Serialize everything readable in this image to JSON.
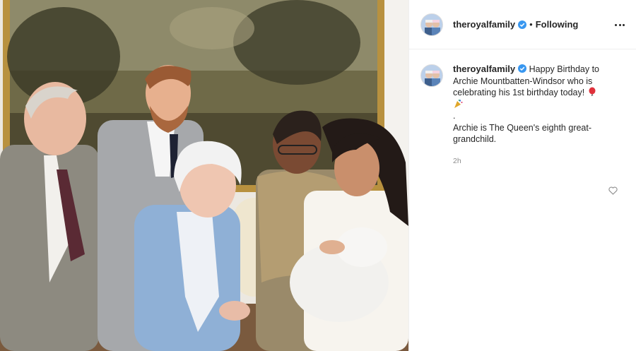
{
  "post": {
    "username": "theroyalfamily",
    "separator": "•",
    "follow_status": "Following",
    "caption_lines": [
      "Happy Birthday to",
      "Archie Mountbatten-Windsor who is",
      "celebrating his 1st birthday today!"
    ],
    "caption_dot": ".",
    "caption_line2": "Archie is The Queen's eighth great-",
    "caption_line3": "grandchild.",
    "timestamp": "2h"
  },
  "icons": {
    "verified": "verified-badge-icon",
    "more": "more-options-icon",
    "like": "heart-icon",
    "emoji1": "balloon-emoji",
    "emoji2": "party-popper-emoji"
  },
  "colors": {
    "verified_blue": "#3897f0",
    "text": "#262626",
    "muted": "#8e8e8e",
    "border": "#efefef"
  }
}
